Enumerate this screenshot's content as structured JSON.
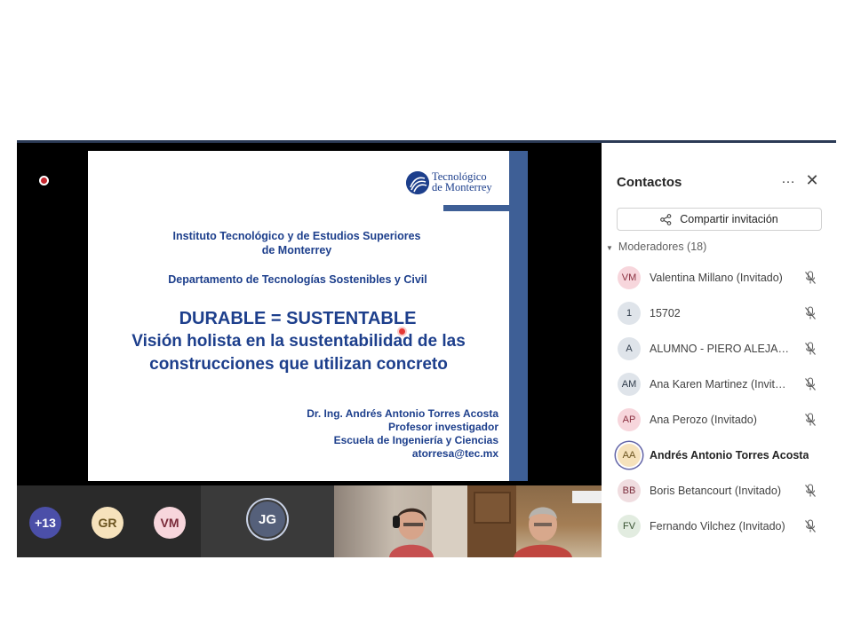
{
  "stage": {
    "slide": {
      "logo_line1": "Tecnológico",
      "logo_line2": "de Monterrey",
      "institution_line1": "Instituto Tecnológico y de Estudios Superiores",
      "institution_line2": "de Monterrey",
      "department": "Departamento de Tecnologías Sostenibles y Civil",
      "title_line1": "DURABLE = SUSTENTABLE",
      "title_line2": "Visión holista en la sustentabilidad de las",
      "title_line3": "construcciones que utilizan concreto",
      "author": "Dr. Ing. Andrés Antonio Torres Acosta",
      "role": "Profesor investigador",
      "school": "Escuela de Ingeniería y Ciencias",
      "email": "atorresa@tec.mx"
    }
  },
  "strip": {
    "overflow_count": "+13",
    "avatars": [
      {
        "initials": "GR",
        "bg": "#f6e2bc",
        "fg": "#6b5420"
      },
      {
        "initials": "VM",
        "bg": "#f7d6dc",
        "fg": "#7a2b3a"
      }
    ],
    "speaker_initials": "JG"
  },
  "panel": {
    "title": "Contactos",
    "more_icon": "…",
    "close_icon": "✕",
    "share_label": "Compartir invitación",
    "moderators_label": "Moderadores (18)",
    "participants": [
      {
        "initials": "VM",
        "name": "Valentina Millano (Invitado)",
        "muted": true,
        "bg": "#f7d6dc",
        "fg": "#8a3040"
      },
      {
        "initials": "1",
        "name": "15702",
        "muted": true,
        "bg": "#dfe4ea",
        "fg": "#2f3b4a"
      },
      {
        "initials": "A",
        "name": "ALUMNO - PIERO ALEJAND...",
        "muted": true,
        "bg": "#dfe4ea",
        "fg": "#2f3b4a"
      },
      {
        "initials": "AM",
        "name": "Ana Karen Martinez (Invitado)",
        "muted": true,
        "bg": "#dfe4ea",
        "fg": "#2f3b4a"
      },
      {
        "initials": "AP",
        "name": "Ana Perozo (Invitado)",
        "muted": true,
        "bg": "#f7d6dc",
        "fg": "#8a3040"
      },
      {
        "initials": "AA",
        "name": "Andrés Antonio Torres Acosta",
        "muted": false,
        "bold": true,
        "bg": "#f6e2bc",
        "fg": "#6b5420"
      },
      {
        "initials": "BB",
        "name": "Boris Betancourt (Invitado)",
        "muted": true,
        "bg": "#f0dde0",
        "fg": "#7a2b3a"
      },
      {
        "initials": "FV",
        "name": "Fernando Vilchez (Invitado)",
        "muted": true,
        "bg": "#e2ece0",
        "fg": "#36502f"
      }
    ]
  }
}
